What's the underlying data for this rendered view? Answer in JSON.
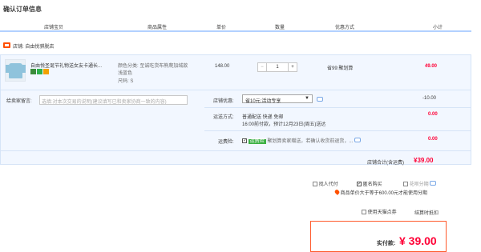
{
  "page": {
    "title": "确认订单信息"
  },
  "table_headers": [
    "店铺宝贝",
    "商品属性",
    "单价",
    "数量",
    "优惠方式",
    "小计"
  ],
  "shop": {
    "label": "店铺: 自由悦骐脱店"
  },
  "product": {
    "name": "自由悦圣诞节礼物送女友卡通长...",
    "attr_color": "颜色分类: 至诚吃货布熊爬加绒款",
    "attr_color2": "浅蓝色",
    "attr_size": "尺码: S",
    "price": "148.00",
    "qty": "1",
    "qty_minus": "−",
    "qty_plus": "+",
    "discount": "省99:聚划算",
    "subtotal": "49.00"
  },
  "message": {
    "label": "给卖家留言:",
    "placeholder": "选填:对本次交易的说明(建议填写已和卖家协商一致的内容)"
  },
  "shop_coupon": {
    "label": "店铺优惠:",
    "selected": "省10元:活动专享",
    "amount": "-10.00"
  },
  "shipping": {
    "label": "运送方式:",
    "method": "普通配送 快递 免邮",
    "eta": "16:00前付款，预计12月23日(周五)送达",
    "amount": "0.00"
  },
  "insurance": {
    "label": "运费险:",
    "tag": "运费险",
    "desc": "聚划算卖家赠送，若确认收货前退货，...",
    "amount": "0.00"
  },
  "shop_total": {
    "label": "店铺合计(含运费)",
    "amount": "¥39.00"
  },
  "options": {
    "proxy_pay": "找人代付",
    "anonymous": "匿名购买",
    "installment": "花呗分期",
    "installment_note": "商品单价大于等于600.00元才能使用分期",
    "tmall_points": "使用天猫点券",
    "settle_label": "结算时抵扣"
  },
  "payment": {
    "label": "实付款:",
    "amount": "¥ 39.00"
  },
  "colors": {
    "accent": "#ff0036",
    "header_line": "#b2d1ff",
    "block_bg": "#f2f7ff"
  }
}
